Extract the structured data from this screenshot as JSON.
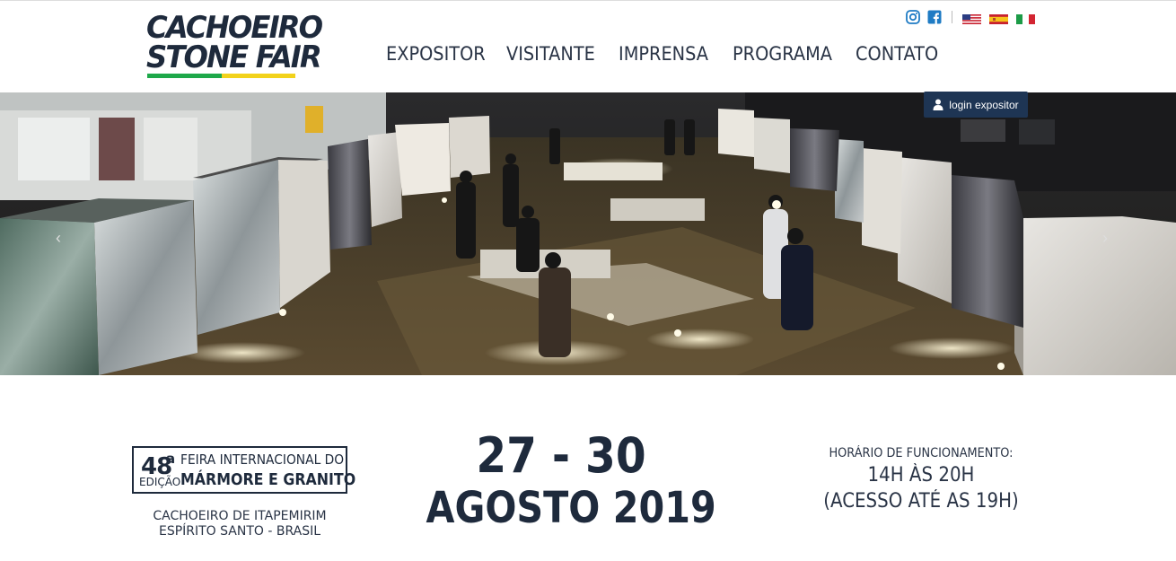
{
  "logo": {
    "line1": "CACHOEIRO",
    "line2": "STONE FAIR"
  },
  "nav": {
    "items": [
      {
        "label": "EXPOSITOR"
      },
      {
        "label": "VISITANTE"
      },
      {
        "label": "IMPRENSA"
      },
      {
        "label": "PROGRAMA"
      },
      {
        "label": "CONTATO"
      }
    ]
  },
  "social": {
    "icons": [
      "instagram-icon",
      "facebook-icon"
    ],
    "languages": [
      "flag-en-icon",
      "flag-es-icon",
      "flag-it-icon"
    ]
  },
  "hero": {
    "login_label": "login expositor"
  },
  "badge": {
    "number": "48",
    "superscript": "a",
    "line1": "FEIRA INTERNACIONAL DO",
    "small": "EDIÇÃO",
    "line2": "MÁRMORE E GRANITO"
  },
  "location": {
    "line1": "CACHOEIRO DE ITAPEMIRIM",
    "line2": "ESPÍRITO SANTO - BRASIL"
  },
  "dates": {
    "days": "27 - 30",
    "month_year": "AGOSTO 2019"
  },
  "hours": {
    "label": "HORÁRIO DE FUNCIONAMENTO:",
    "time": "14H ÀS 20H",
    "note": "(ACESSO ATÉ AS 19H)"
  },
  "colors": {
    "brand_navy": "#1e2a3c",
    "login_bg": "#1e3554",
    "stripe_green": "#1ea84a",
    "stripe_yellow": "#f2d21b"
  }
}
